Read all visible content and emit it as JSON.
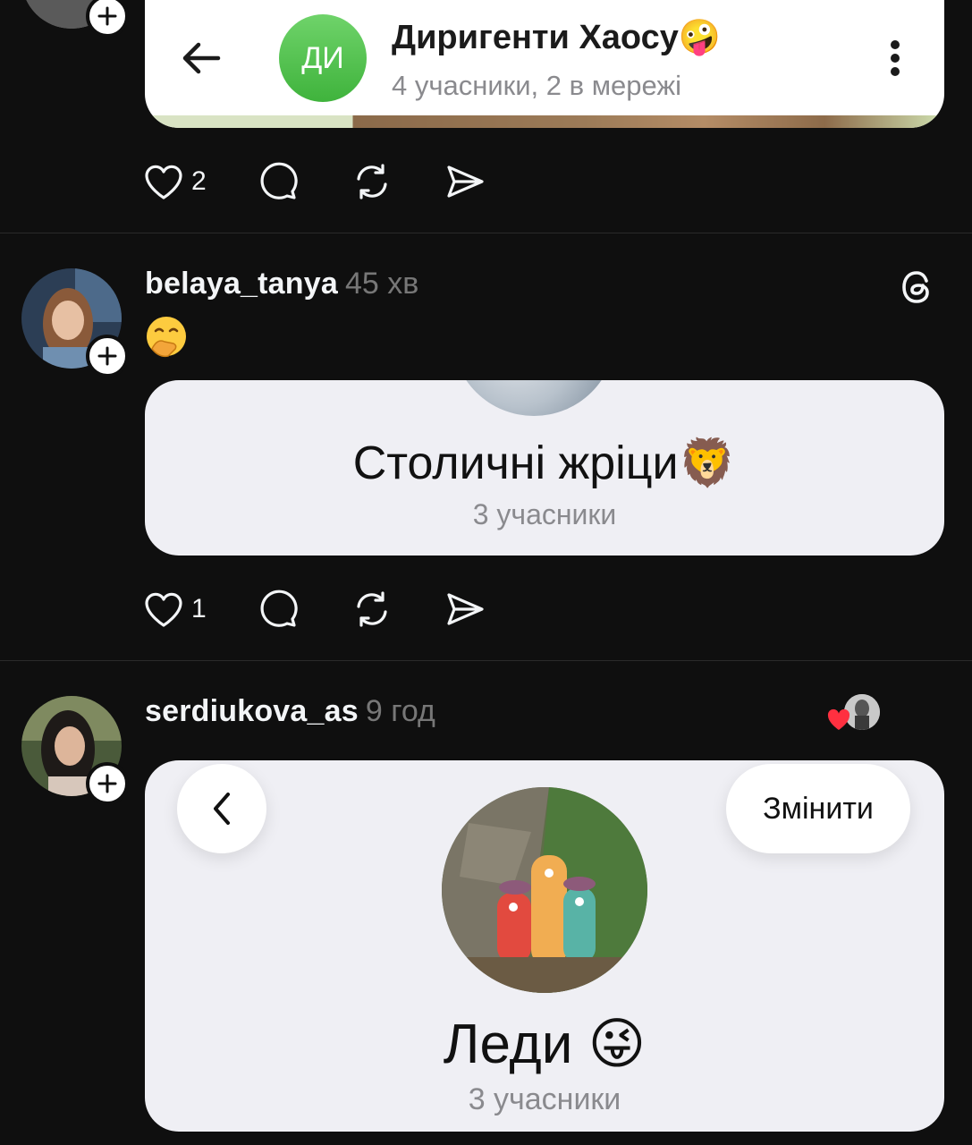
{
  "posts": [
    {
      "chat_card": {
        "avatar_initials": "ДИ",
        "title": "Диригенти Хаосу🤪",
        "subtitle": "4 учасники, 2 в мережі",
        "back_icon": "arrow-left-icon",
        "menu_icon": "more-vertical-icon"
      },
      "actions": {
        "likes": "2"
      }
    },
    {
      "username": "belaya_tanya",
      "time": "45 хв",
      "text": "🤭",
      "card": {
        "title": "Столичні жріци🦁",
        "subtitle": "3 учасники"
      },
      "actions": {
        "likes": "1"
      }
    },
    {
      "username": "serdiukova_as",
      "time": "9 год",
      "card": {
        "edit_label": "Змінити",
        "title": "Леди 😜",
        "subtitle": "3 учасники"
      }
    }
  ],
  "colors": {
    "background": "#0f0f0f",
    "chat_avatar": "#4cbf48",
    "like_heart": "#ff3040"
  }
}
